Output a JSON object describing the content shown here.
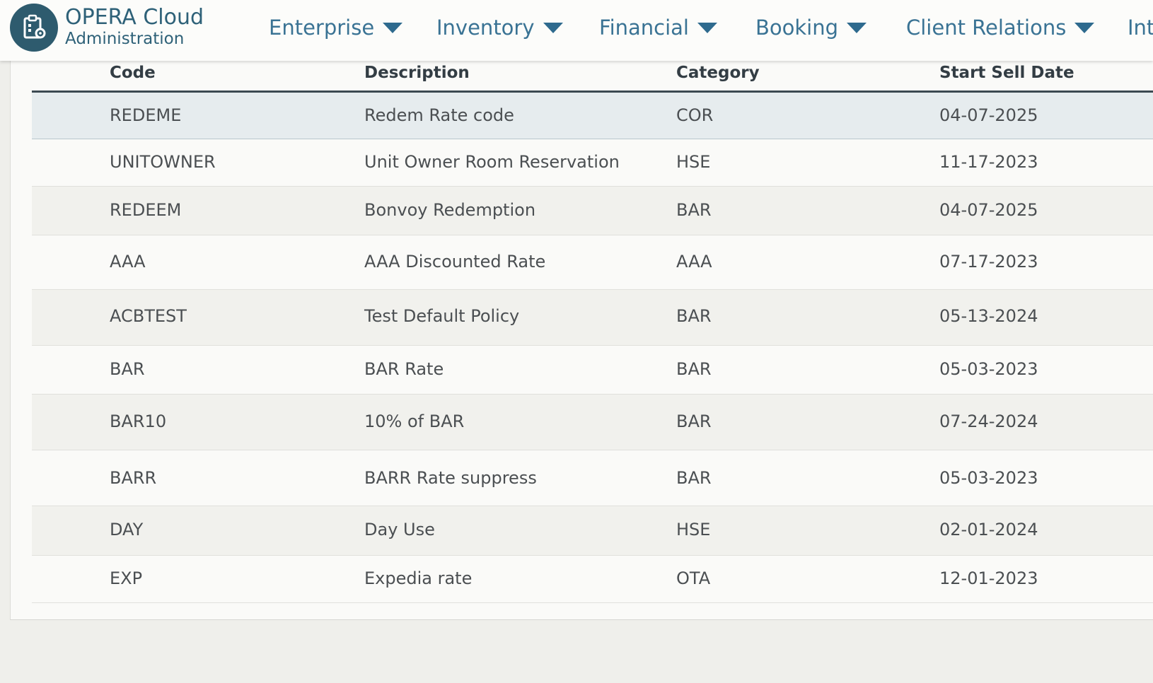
{
  "app": {
    "title": "OPERA Cloud",
    "subtitle": "Administration",
    "logo_icon": "clipboard-gear-icon"
  },
  "nav": {
    "items": [
      {
        "label": "Enterprise"
      },
      {
        "label": "Inventory"
      },
      {
        "label": "Financial"
      },
      {
        "label": "Booking"
      },
      {
        "label": "Client Relations"
      },
      {
        "label": "Int"
      }
    ]
  },
  "table": {
    "headers": {
      "code": "Code",
      "description": "Description",
      "category": "Category",
      "start_sell_date": "Start Sell Date"
    },
    "rows": [
      {
        "code": "REDEME",
        "description": "Redem Rate code",
        "category": "COR",
        "start_sell_date": "04-07-2025",
        "selected": true
      },
      {
        "code": "UNITOWNER",
        "description": "Unit Owner Room Reservation",
        "category": "HSE",
        "start_sell_date": "11-17-2023"
      },
      {
        "code": "REDEEM",
        "description": "Bonvoy Redemption",
        "category": "BAR",
        "start_sell_date": "04-07-2025"
      },
      {
        "code": "AAA",
        "description": "AAA Discounted Rate",
        "category": "AAA",
        "start_sell_date": "07-17-2023"
      },
      {
        "code": "ACBTEST",
        "description": "Test Default Policy",
        "category": "BAR",
        "start_sell_date": "05-13-2024"
      },
      {
        "code": "BAR",
        "description": "BAR Rate",
        "category": "BAR",
        "start_sell_date": "05-03-2023"
      },
      {
        "code": "BAR10",
        "description": "10% of BAR",
        "category": "BAR",
        "start_sell_date": "07-24-2024"
      },
      {
        "code": "BARR",
        "description": "BARR Rate suppress",
        "category": "BAR",
        "start_sell_date": "05-03-2023"
      },
      {
        "code": "DAY",
        "description": "Day Use",
        "category": "HSE",
        "start_sell_date": "02-01-2024"
      },
      {
        "code": "EXP",
        "description": "Expedia rate",
        "category": "OTA",
        "start_sell_date": "12-01-2023"
      }
    ]
  },
  "colors": {
    "brand": "#2e5b6e",
    "nav_text": "#3a7394",
    "selected_row": "#e6ecee"
  }
}
